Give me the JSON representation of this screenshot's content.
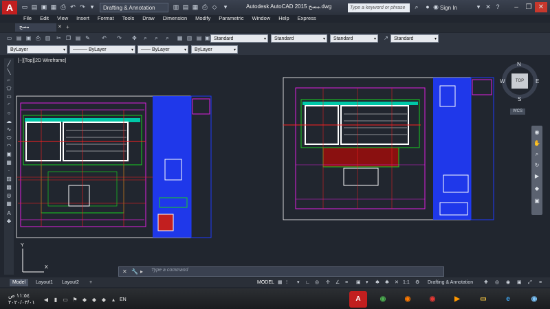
{
  "title_bar": {
    "workspace": "Drafting & Annotation",
    "title": "Autodesk AutoCAD 2015  مسح.dwg",
    "search_placeholder": "Type a keyword or phrase",
    "sign_in": "Sign In",
    "app_letter": "A"
  },
  "menu": [
    "File",
    "Edit",
    "View",
    "Insert",
    "Format",
    "Tools",
    "Draw",
    "Dimension",
    "Modify",
    "Parametric",
    "Window",
    "Help",
    "Express"
  ],
  "doc_tab": "مسح",
  "toolbar1": {
    "styles": [
      "Standard",
      "Standard",
      "Standard",
      "Standard"
    ]
  },
  "toolbar2": {
    "layer": "ByLayer",
    "linetype": "ByLayer",
    "lineweight": "ByLayer",
    "color": "ByLayer"
  },
  "viewport_label": "[−][Top][2D Wireframe]",
  "viewcube": {
    "top": "TOP",
    "n": "N",
    "s": "S",
    "e": "E",
    "w": "W",
    "wcs": "WCS"
  },
  "ucs": {
    "x": "X",
    "y": "Y"
  },
  "command_placeholder": "Type a command",
  "layout_tabs": [
    "Model",
    "Layout1",
    "Layout2"
  ],
  "add_tab": "+",
  "status": {
    "mode": "MODEL",
    "scale": "1:1",
    "workspace": "Drafting & Annotation"
  },
  "taskbar": {
    "time": "١١:٥٤ ص",
    "date": "٢٠٢٠/٠٣/٠١",
    "lang": "EN"
  },
  "colors": {
    "accent_red": "#c21f1f",
    "drawing_bg": "#21262f",
    "blue_frame": "#1f3bff",
    "magenta": "#e020e0",
    "green": "#18d020",
    "red_line": "#ff2020",
    "white": "#ffffff"
  }
}
